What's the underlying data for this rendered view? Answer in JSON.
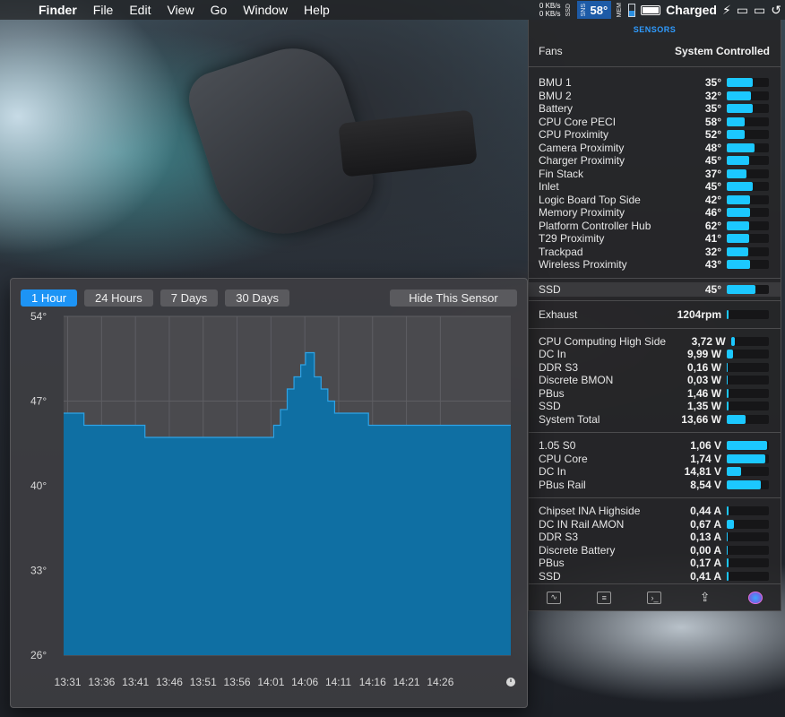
{
  "menubar": {
    "apple": "",
    "items": [
      "Finder",
      "File",
      "Edit",
      "View",
      "Go",
      "Window",
      "Help"
    ],
    "net_up": "0 KB/s",
    "net_down": "0 KB/s",
    "temp_label": "58°",
    "battery_status": "Charged"
  },
  "sensors": {
    "title": "SENSORS",
    "fans_label": "Fans",
    "fans_value": "System Controlled",
    "temperatures": [
      {
        "label": "BMU 1",
        "value": "35°",
        "level": 0.62
      },
      {
        "label": "BMU 2",
        "value": "32°",
        "level": 0.57
      },
      {
        "label": "Battery",
        "value": "35°",
        "level": 0.62
      },
      {
        "label": "CPU Core PECI",
        "value": "58°",
        "level": 0.43
      },
      {
        "label": "CPU Proximity",
        "value": "52°",
        "level": 0.43
      },
      {
        "label": "Camera Proximity",
        "value": "48°",
        "level": 0.65
      },
      {
        "label": "Charger Proximity",
        "value": "45°",
        "level": 0.53
      },
      {
        "label": "Fin Stack",
        "value": "37°",
        "level": 0.47
      },
      {
        "label": "Inlet",
        "value": "45°",
        "level": 0.62
      },
      {
        "label": "Logic Board Top Side",
        "value": "42°",
        "level": 0.55
      },
      {
        "label": "Memory Proximity",
        "value": "46°",
        "level": 0.55
      },
      {
        "label": "Platform Controller Hub",
        "value": "62°",
        "level": 0.53
      },
      {
        "label": "T29 Proximity",
        "value": "41°",
        "level": 0.53
      },
      {
        "label": "Trackpad",
        "value": "32°",
        "level": 0.5
      },
      {
        "label": "Wireless Proximity",
        "value": "43°",
        "level": 0.55
      }
    ],
    "ssd": {
      "label": "SSD",
      "value": "45°",
      "level": 0.68
    },
    "exhaust": {
      "label": "Exhaust",
      "value": "1204rpm",
      "level": 0.04
    },
    "power": [
      {
        "label": "CPU Computing High Side",
        "value": "3,72 W",
        "level": 0.1
      },
      {
        "label": "DC In",
        "value": "9,99 W",
        "level": 0.14
      },
      {
        "label": "DDR S3",
        "value": "0,16 W",
        "level": 0.03
      },
      {
        "label": "Discrete BMON",
        "value": "0,03 W",
        "level": 0.02
      },
      {
        "label": "PBus",
        "value": "1,46 W",
        "level": 0.05
      },
      {
        "label": "SSD",
        "value": "1,35 W",
        "level": 0.05
      },
      {
        "label": "System Total",
        "value": "13,66 W",
        "level": 0.45
      }
    ],
    "voltage": [
      {
        "label": "1.05 S0",
        "value": "1,06 V",
        "level": 0.96
      },
      {
        "label": "CPU Core",
        "value": "1,74 V",
        "level": 0.92
      },
      {
        "label": "DC In",
        "value": "14,81 V",
        "level": 0.35
      },
      {
        "label": "PBus Rail",
        "value": "8,54 V",
        "level": 0.8
      }
    ],
    "current": [
      {
        "label": "Chipset INA Highside",
        "value": "0,44 A",
        "level": 0.05
      },
      {
        "label": "DC IN Rail AMON",
        "value": "0,67 A",
        "level": 0.18
      },
      {
        "label": "DDR S3",
        "value": "0,13 A",
        "level": 0.03
      },
      {
        "label": "Discrete Battery",
        "value": "0,00 A",
        "level": 0.02
      },
      {
        "label": "PBus",
        "value": "0,17 A",
        "level": 0.04
      },
      {
        "label": "SSD",
        "value": "0,41 A",
        "level": 0.05
      }
    ]
  },
  "graph_window": {
    "tabs": [
      "1 Hour",
      "24 Hours",
      "7 Days",
      "30 Days"
    ],
    "active_tab": "1 Hour",
    "hide_button": "Hide This Sensor"
  },
  "chart_data": {
    "type": "area",
    "ylim": [
      26,
      54
    ],
    "yticks": [
      "54°",
      "47°",
      "40°",
      "33°",
      "26°"
    ],
    "xticks": [
      "13:31",
      "13:36",
      "13:41",
      "13:46",
      "13:51",
      "13:56",
      "14:01",
      "14:06",
      "14:11",
      "14:16",
      "14:21",
      "14:26"
    ],
    "x_minutes": [
      0,
      3,
      3,
      12,
      12,
      31,
      31,
      32,
      32,
      33,
      33,
      34,
      34,
      35,
      35,
      35.7,
      35.7,
      37,
      37,
      38,
      38,
      39,
      39,
      40,
      40,
      45,
      45,
      66
    ],
    "y": [
      46,
      46,
      45,
      45,
      44,
      44,
      45,
      45,
      46.3,
      46.3,
      48,
      48,
      49,
      49,
      50,
      50,
      51,
      51,
      49,
      49,
      48,
      48,
      47,
      47,
      46,
      46,
      45,
      45
    ],
    "fill_color": "#0f6fa3",
    "line_color": "#2ea3e6",
    "grid": true
  }
}
